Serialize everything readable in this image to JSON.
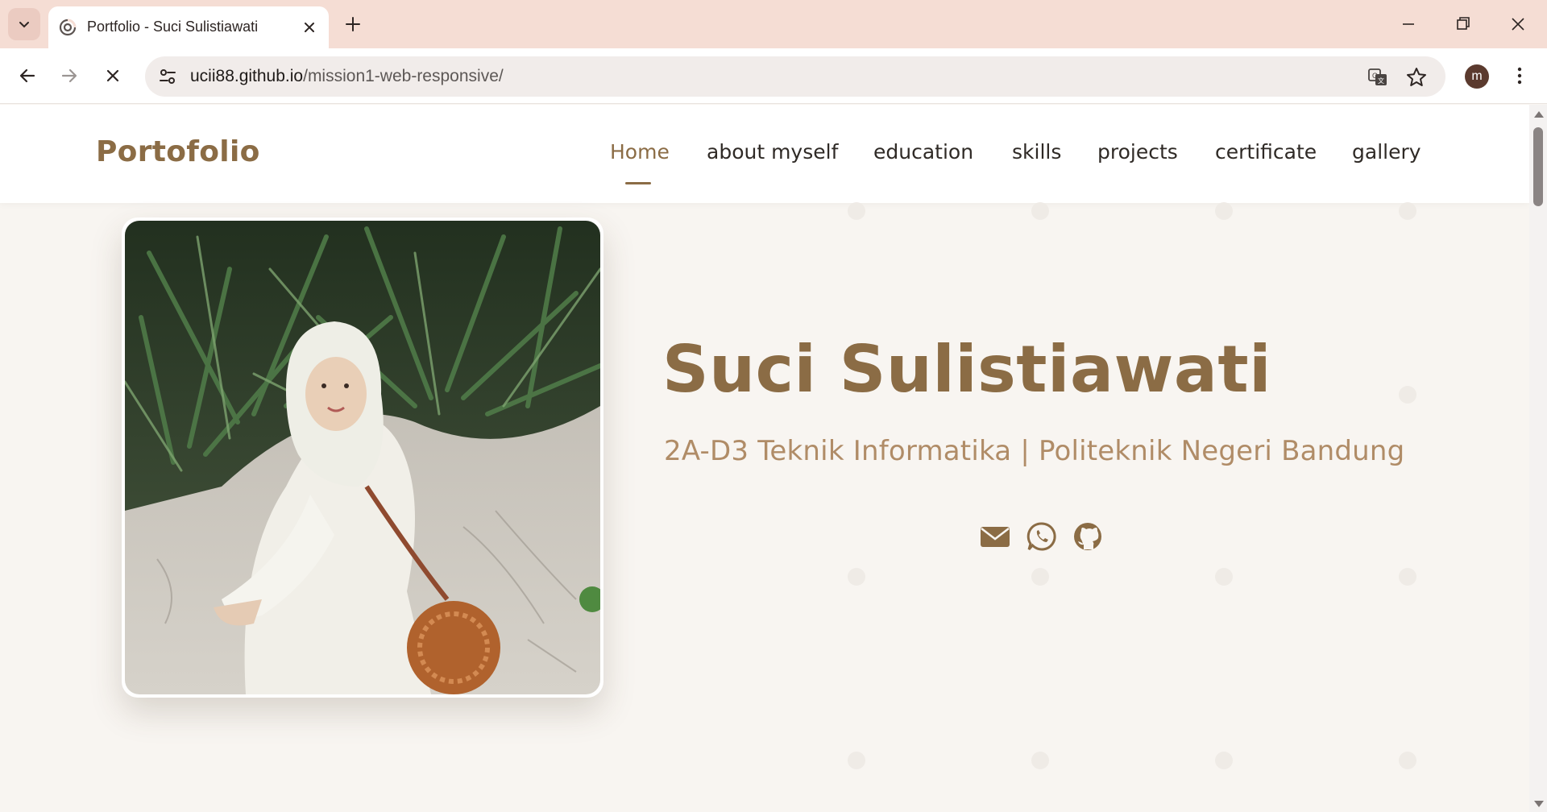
{
  "browser": {
    "tab": {
      "title": "Portfolio - Suci Sulistiawati"
    },
    "url": {
      "host": "ucii88.github.io",
      "path": "/mission1-web-responsive/"
    },
    "profile_initial": "m",
    "icons": [
      "tab-search-icon",
      "favicon-icon",
      "close-icon",
      "plus-icon",
      "minimize-icon",
      "restore-icon",
      "close-window-icon",
      "back-arrow-icon",
      "forward-arrow-icon",
      "stop-loading-icon",
      "site-settings-icon",
      "translate-icon",
      "star-icon",
      "kebab-menu-icon"
    ]
  },
  "site": {
    "brand": "Portofolio",
    "nav": [
      {
        "label": "Home",
        "active": true
      },
      {
        "label": "about myself",
        "active": false
      },
      {
        "label": "education",
        "active": false
      },
      {
        "label": "skills",
        "active": false
      },
      {
        "label": "projects",
        "active": false
      },
      {
        "label": "certificate",
        "active": false
      },
      {
        "label": "gallery",
        "active": false
      }
    ],
    "hero": {
      "name": "Suci Sulistiawati",
      "subtitle": "2A-D3 Teknik Informatika | Politeknik Negeri Bandung",
      "social_icons": [
        "envelope-icon",
        "whatsapp-icon",
        "github-icon"
      ]
    }
  },
  "colors": {
    "brand": "#8b6c45",
    "subtitle": "#b08c67",
    "tabbar": "#f5ddd4",
    "page_bg": "#f8f5f1"
  }
}
